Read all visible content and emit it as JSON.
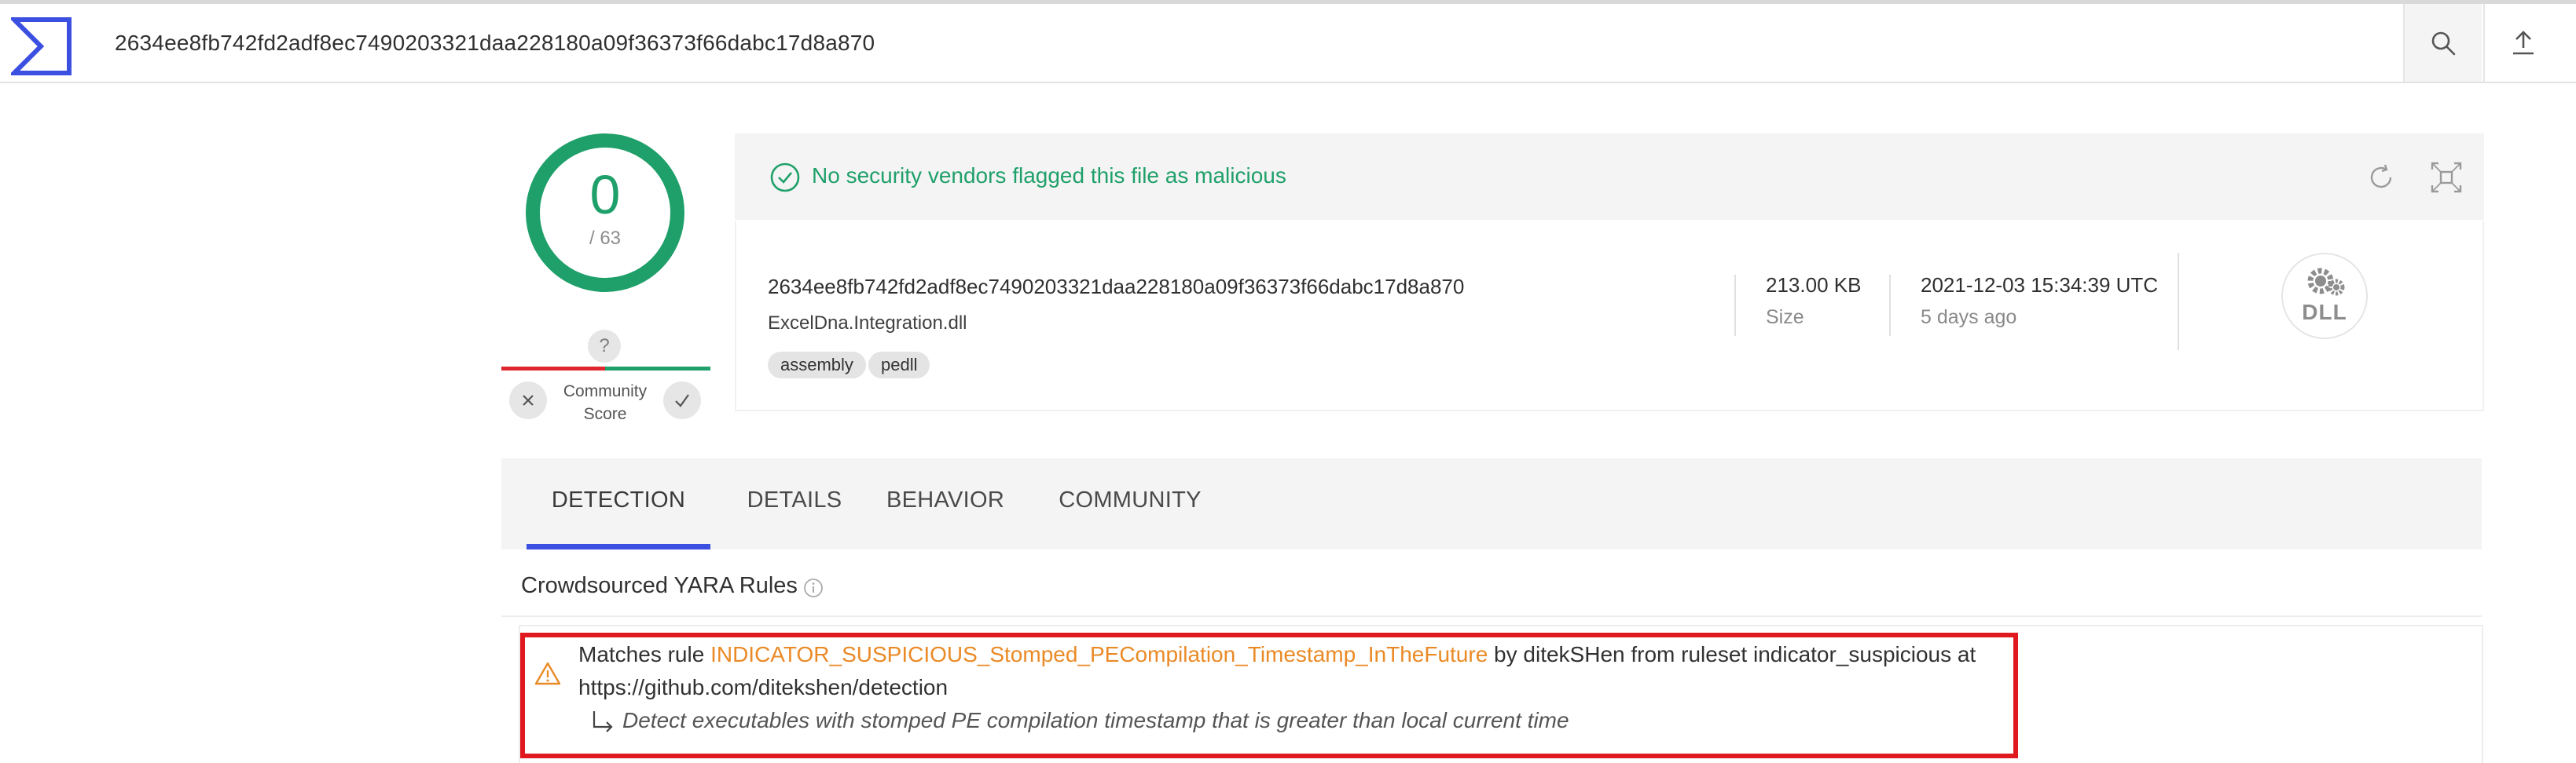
{
  "search": {
    "value": "2634ee8fb742fd2adf8ec7490203321daa228180a09f36373f66dabc17d8a870"
  },
  "icons": {
    "logo": "virustotal-sigma-logo",
    "search": "search-icon",
    "upload": "upload-icon"
  },
  "colors": {
    "accent": "#3b4fe0",
    "clean": "#1fa06a",
    "malicious": "#e0262c",
    "rule_link": "#ea8a26",
    "highlight_box": "#e0191f"
  },
  "score": {
    "detections": "0",
    "total": "/ 63",
    "community_question": "?",
    "community_label_1": "Community",
    "community_label_2": "Score"
  },
  "summary": {
    "status": "No security vendors flagged this file as malicious",
    "hash": "2634ee8fb742fd2adf8ec7490203321daa228180a09f36373f66dabc17d8a870",
    "filename": "ExcelDna.Integration.dll",
    "tags": [
      "assembly",
      "pedll"
    ],
    "size_value": "213.00 KB",
    "size_label": "Size",
    "date_value": "2021-12-03 15:34:39 UTC",
    "date_label": "5 days ago",
    "file_type_badge": "DLL"
  },
  "tabs": {
    "detection": "DETECTION",
    "details": "DETAILS",
    "behavior": "BEHAVIOR",
    "community": "COMMUNITY",
    "active": "DETECTION"
  },
  "yara": {
    "section_title": "Crowdsourced YARA Rules",
    "prefix": "Matches rule ",
    "rule_name": "INDICATOR_SUSPICIOUS_Stomped_PECompilation_Timestamp_InTheFuture",
    "suffix": " by ditekSHen from ruleset indicator_suspicious at",
    "url": "https://github.com/ditekshen/detection",
    "description": "Detect executables with stomped PE compilation timestamp that is greater than local current time"
  }
}
